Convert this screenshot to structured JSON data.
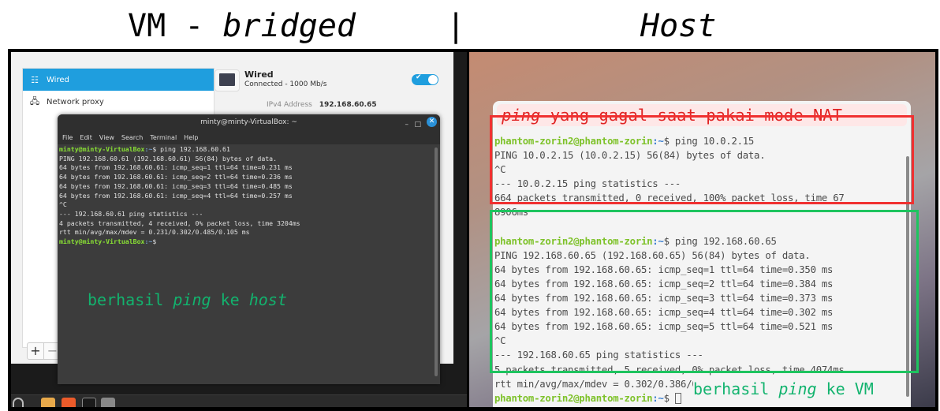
{
  "headings": {
    "vm_prefix": "VM - ",
    "vm_mode": "bridged",
    "separator": "|",
    "host": "Host"
  },
  "vm": {
    "settings": {
      "sidebar": [
        {
          "label": "Wired",
          "icon": "network-wired-icon",
          "active": true
        },
        {
          "label": "Network proxy",
          "icon": "network-proxy-icon",
          "active": false
        }
      ],
      "add_label": "+",
      "remove_label": "−",
      "wired": {
        "title": "Wired",
        "status": "Connected - 1000 Mb/s",
        "enabled": true,
        "ipv4_label": "IPv4 Address",
        "ipv4_value": "192.168.60.65"
      }
    },
    "terminal": {
      "title": "minty@minty-VirtualBox: ~",
      "menu": [
        "File",
        "Edit",
        "View",
        "Search",
        "Terminal",
        "Help"
      ],
      "prompt_user": "minty@minty-VirtualBox",
      "prompt_path": ":~",
      "prompt_symbol": "$",
      "command": " ping 192.168.60.61",
      "lines": [
        "PING 192.168.60.61 (192.168.60.61) 56(84) bytes of data.",
        "64 bytes from 192.168.60.61: icmp_seq=1 ttl=64 time=0.231 ms",
        "64 bytes from 192.168.60.61: icmp_seq=2 ttl=64 time=0.236 ms",
        "64 bytes from 192.168.60.61: icmp_seq=3 ttl=64 time=0.485 ms",
        "64 bytes from 192.168.60.61: icmp_seq=4 ttl=64 time=0.257 ms",
        "^C",
        "--- 192.168.60.61 ping statistics ---",
        "4 packets transmitted, 4 received, 0% packet loss, time 3204ms",
        "rtt min/avg/max/mdev = 0.231/0.302/0.485/0.105 ms"
      ]
    },
    "annotation": {
      "part1": "berhasil ",
      "part2": "ping",
      "part3": " ke ",
      "part4": "host"
    },
    "taskbar": [
      "menu-icon",
      "files-icon",
      "software-store-icon",
      "terminal-icon",
      "network-icon"
    ]
  },
  "host": {
    "terminal": {
      "prompt_user": "phantom-zorin2@phantom-zorin",
      "prompt_path": ":~",
      "prompt_symbol": "$",
      "nat_command": " ping 10.0.2.15",
      "nat_lines": [
        "PING 10.0.2.15 (10.0.2.15) 56(84) bytes of data.",
        "^C",
        "--- 10.0.2.15 ping statistics ---",
        "664 packets transmitted, 0 received, 100% packet loss, time 67",
        "8906ms"
      ],
      "bridged_command": " ping 192.168.60.65",
      "bridged_lines": [
        "PING 192.168.60.65 (192.168.60.65) 56(84) bytes of data.",
        "64 bytes from 192.168.60.65: icmp_seq=1 ttl=64 time=0.350 ms",
        "64 bytes from 192.168.60.65: icmp_seq=2 ttl=64 time=0.384 ms",
        "64 bytes from 192.168.60.65: icmp_seq=3 ttl=64 time=0.373 ms",
        "64 bytes from 192.168.60.65: icmp_seq=4 ttl=64 time=0.302 ms",
        "64 bytes from 192.168.60.65: icmp_seq=5 ttl=64 time=0.521 ms",
        "^C",
        "--- 192.168.60.65 ping statistics ---",
        "5 packets transmitted, 5 received, 0% packet loss, time 4074ms",
        "rtt min/avg/max/mdev = 0.302/0.386/0.521/0.073 ms"
      ]
    },
    "nat_annotation": {
      "part1": "ping",
      "part2": " yang gagal saat pakai mode NAT"
    },
    "vm_annotation": {
      "part1": "berhasil ",
      "part2": "ping",
      "part3": " ke VM"
    }
  },
  "colors": {
    "fail_box": "#f03030",
    "success_box": "#1ec45f",
    "annotation_green": "#12b36e",
    "annotation_red": "#e02424",
    "accent_blue": "#1f9ede"
  }
}
